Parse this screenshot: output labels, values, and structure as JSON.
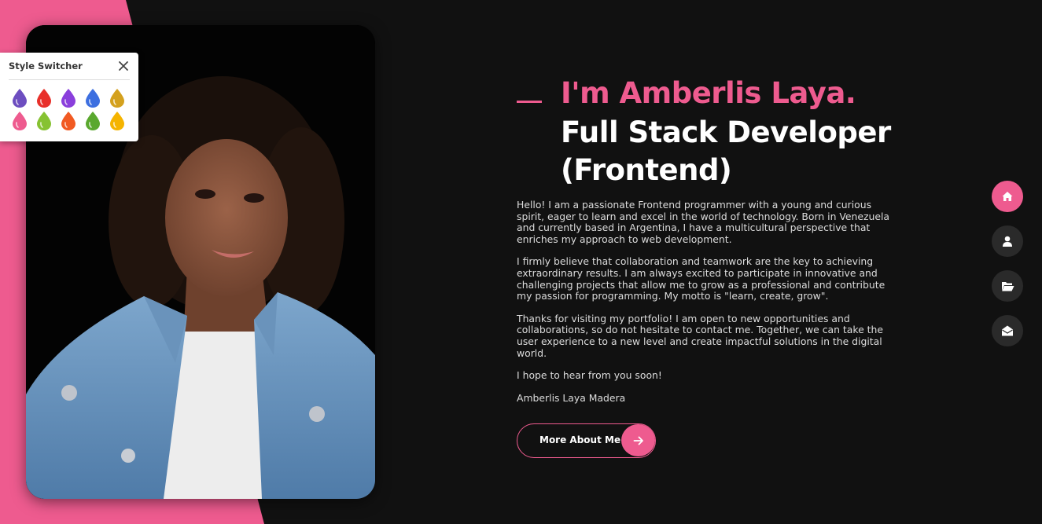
{
  "colors": {
    "accent": "#ee5b8f",
    "background": "#111111",
    "text": "#dcdcdc"
  },
  "style_switcher": {
    "title": "Style Switcher",
    "close_icon": "close-icon",
    "swatches": [
      "#6d4ec0",
      "#e8302a",
      "#8a3fdc",
      "#3d6fe0",
      "#d4a11e",
      "#ee5b8f",
      "#86c232",
      "#f15a22",
      "#5aa82e",
      "#f5b400"
    ]
  },
  "hero": {
    "name": "I'm Amberlis Laya.",
    "role": "Full Stack Developer (Frontend)",
    "paragraphs": [
      "Hello! I am a passionate Frontend programmer with a young and curious spirit, eager to learn and excel in the world of technology. Born in Venezuela and currently based in Argentina, I have a multicultural perspective that enriches my approach to web development.",
      "I firmly believe that collaboration and teamwork are the key to achieving extraordinary results. I am always excited to participate in innovative and challenging projects that allow me to grow as a professional and contribute my passion for programming. My motto is \"learn, create, grow\".",
      "Thanks for visiting my portfolio! I am open to new opportunities and collaborations, so do not hesitate to contact me. Together, we can take the user experience to a new level and create impactful solutions in the digital world.",
      "I hope to hear from you soon!"
    ],
    "signature": "Amberlis Laya Madera",
    "button_label": "More About Me",
    "button_icon": "arrow-right-icon"
  },
  "side_nav": [
    {
      "icon": "home-icon",
      "active": true
    },
    {
      "icon": "user-icon",
      "active": false
    },
    {
      "icon": "folder-open-icon",
      "active": false
    },
    {
      "icon": "envelope-open-icon",
      "active": false
    }
  ]
}
